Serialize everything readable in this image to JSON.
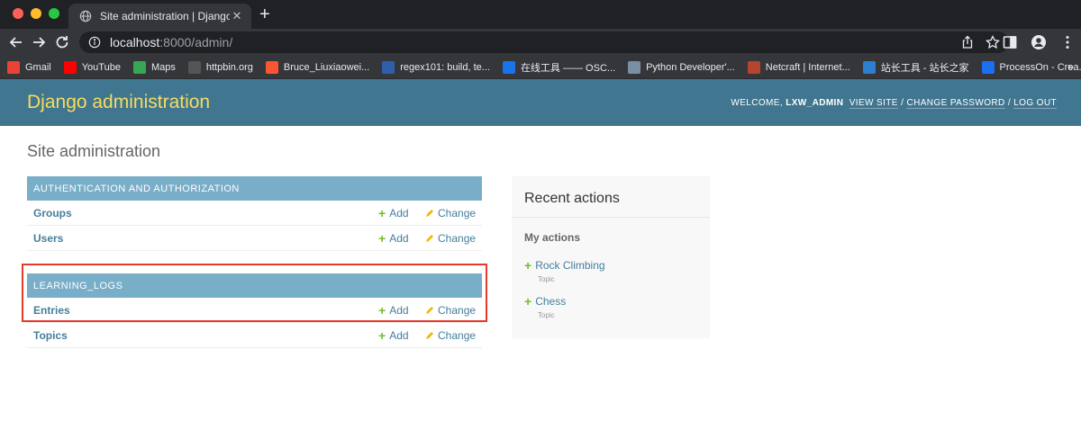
{
  "browser": {
    "tab_title": "Site administration | Django site admin",
    "url_host": "localhost",
    "url_rest": ":8000/admin/",
    "bookmarks": [
      {
        "label": "Gmail",
        "icon": "gmail-icon",
        "color": "#ea4335"
      },
      {
        "label": "YouTube",
        "icon": "youtube-icon",
        "color": "#ff0000"
      },
      {
        "label": "Maps",
        "icon": "maps-icon",
        "color": "#34a853"
      },
      {
        "label": "httpbin.org",
        "icon": "httpbin-icon",
        "color": "#555555"
      },
      {
        "label": "Bruce_Liuxiaowei...",
        "icon": "csdn-icon",
        "color": "#fc5531"
      },
      {
        "label": "regex101: build, te...",
        "icon": "regex101-icon",
        "color": "#2f5fa8"
      },
      {
        "label": "在线工具 —— OSC...",
        "icon": "oschina-icon",
        "color": "#1a73e8"
      },
      {
        "label": "Python Developer'...",
        "icon": "python-docs-icon",
        "color": "#7a8fa6"
      },
      {
        "label": "Netcraft | Internet...",
        "icon": "netcraft-icon",
        "color": "#b7442c"
      },
      {
        "label": "站长工具 - 站长之家",
        "icon": "chinaz-icon",
        "color": "#2d7fd0"
      },
      {
        "label": "ProcessOn - Crea...",
        "icon": "processon-icon",
        "color": "#1c6ff0"
      }
    ]
  },
  "admin": {
    "brand": "Django administration",
    "welcome": "WELCOME, ",
    "username": "LXW_ADMIN",
    "view_site": "VIEW SITE",
    "change_password": "CHANGE PASSWORD",
    "log_out": "LOG OUT",
    "page_title": "Site administration",
    "add_label": "Add",
    "change_label": "Change",
    "apps": [
      {
        "caption": "AUTHENTICATION AND AUTHORIZATION",
        "models": [
          "Groups",
          "Users"
        ]
      },
      {
        "caption": "LEARNING_LOGS",
        "models": [
          "Entries",
          "Topics"
        ]
      }
    ],
    "recent": {
      "title": "Recent actions",
      "subtitle": "My actions",
      "items": [
        {
          "name": "Rock Climbing",
          "type": "Topic"
        },
        {
          "name": "Chess",
          "type": "Topic"
        }
      ]
    }
  },
  "colors": {
    "header_bg": "#417690",
    "brand": "#f5dd5d",
    "caption_bg": "#79aec8",
    "link": "#447e9b",
    "add_plus": "#70bf2b",
    "highlight": "#e53b2c"
  }
}
